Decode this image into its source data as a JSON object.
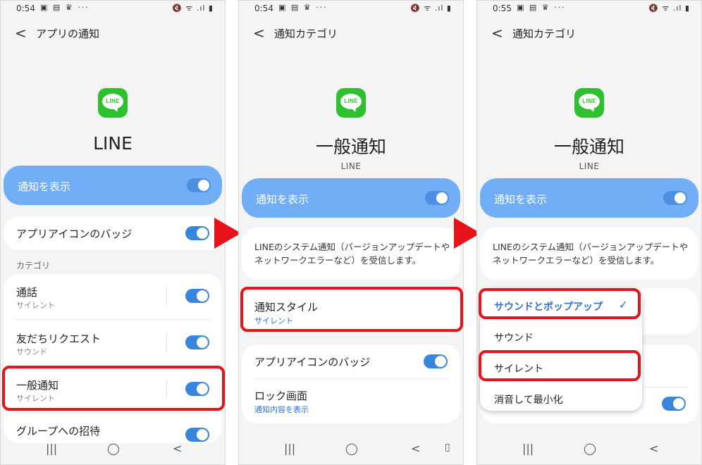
{
  "status": {
    "notif_icons": "▣ ▤ ♛  ···",
    "sys_icons": "🔇 ᯤ .ıl ▮",
    "time1": "0:54",
    "time2": "0:54",
    "time3": "0:55"
  },
  "nav": {
    "recents": "|||",
    "home": "◯",
    "back": "<",
    "extra": "▯"
  },
  "screen1": {
    "back": "<",
    "title": "アプリの通知",
    "logo_text": "LINE",
    "app_name": "LINE",
    "show_notifications": "通知を表示",
    "badge": "アプリアイコンのバッジ",
    "category_header": "カテゴリ",
    "categories": [
      {
        "name": "通話",
        "sub": "サイレント"
      },
      {
        "name": "友だちリクエスト",
        "sub": "サウンド"
      },
      {
        "name": "一般通知",
        "sub": "サイレント"
      },
      {
        "name": "グループへの招待",
        "sub": ""
      }
    ]
  },
  "screen2": {
    "back": "<",
    "title": "通知カテゴリ",
    "logo_text": "LINE",
    "heading": "一般通知",
    "app_name": "LINE",
    "show_notifications": "通知を表示",
    "description": "LINEのシステム通知（バージョンアップデートやネットワークエラーなど）を受信します。",
    "style_label": "通知スタイル",
    "style_value": "サイレント",
    "badge": "アプリアイコンのバッジ",
    "lock_label": "ロック画面",
    "lock_value": "通知内容を表示"
  },
  "screen3": {
    "back": "<",
    "title": "通知カテゴリ",
    "logo_text": "LINE",
    "heading": "一般通知",
    "app_name": "LINE",
    "show_notifications": "通知を表示",
    "description": "LINEのシステム通知（バージョンアップデートやネットワークエラーなど）を受信します。",
    "options": [
      "サウンドとポップアップ",
      "サウンド",
      "サイレント",
      "消音して最小化"
    ],
    "check": "✓"
  },
  "colors": {
    "accent_blue": "#71aef6",
    "toggle_blue": "#3a85dc",
    "highlight_red": "#e8131a",
    "line_green": "#2fc02f"
  }
}
